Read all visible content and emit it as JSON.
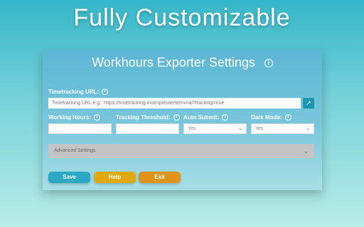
{
  "promo": {
    "title": "Fully Customizable"
  },
  "panel": {
    "title": "Workhours Exporter Settings",
    "timetracking_url": {
      "label": "Timetracking URL:",
      "placeholder": "Timetracking URL e.g.: https://timetracking.examplesite/terminal?tracking=true"
    },
    "working_hours": {
      "label": "Working Hours:",
      "value": ""
    },
    "tracking_threshold": {
      "label": "Tracking Threshold:",
      "value": ""
    },
    "auto_submit": {
      "label": "Auto Submit:",
      "selected": "Yes"
    },
    "dark_mode": {
      "label": "Dark Mode:",
      "selected": "Yes"
    },
    "advanced": {
      "label": "Advanced Settings"
    },
    "buttons": {
      "save": "Save",
      "help": "Help",
      "exit": "Exit"
    }
  },
  "colors": {
    "save": "#2aa8c4",
    "help": "#e2a90d",
    "exit": "#e0941a"
  },
  "icons": {
    "info": "info-icon",
    "open_link": "external-link-icon",
    "dropdown": "chevron-down-icon"
  }
}
